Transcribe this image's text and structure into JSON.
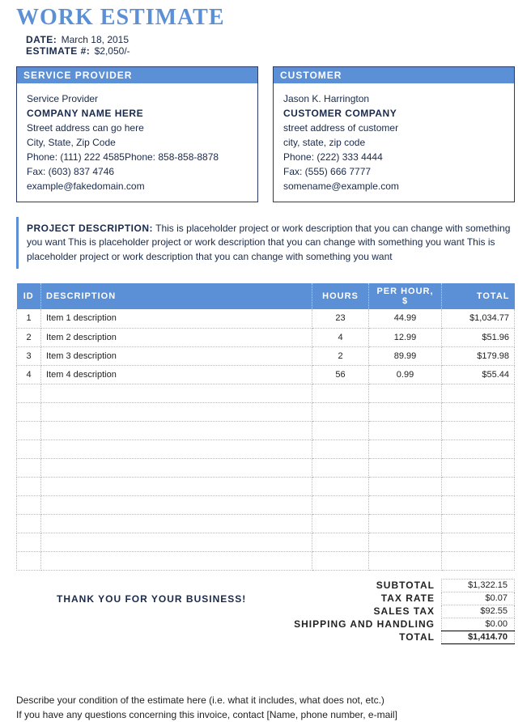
{
  "title": "WORK ESTIMATE",
  "meta": {
    "date_label": "DATE:",
    "date_value": "March 18, 2015",
    "est_label": "ESTIMATE #:",
    "est_value": "$2,050/-"
  },
  "provider": {
    "header": "SERVICE PROVIDER",
    "role": "Service Provider",
    "company": "COMPANY NAME HERE",
    "street": "Street address can go here",
    "citystate": "City, State, Zip Code",
    "phone": "Phone:  (111) 222 4585Phone: 858-858-8878",
    "fax": "Fax: (603) 837 4746",
    "email": "example@fakedomain.com"
  },
  "customer": {
    "header": "CUSTOMER",
    "name": "Jason K. Harrington",
    "company": "CUSTOMER COMPANY",
    "street": "street address of customer",
    "citystate": "city, state, zip code",
    "phone": "Phone: (222) 333 4444",
    "fax": "Fax: (555) 666 7777",
    "email": "somename@example.com"
  },
  "project": {
    "label": "PROJECT DESCRIPTION:",
    "text": "This is placeholder project or work description that you can change with something you want This is placeholder project or work description that you can change with something you want This is placeholder project or work description that you can change with something you want"
  },
  "table": {
    "headers": {
      "id": "ID",
      "desc": "DESCRIPTION",
      "hours": "HOURS",
      "rate": "PER HOUR, $",
      "total": "TOTAL"
    },
    "rows": [
      {
        "id": "1",
        "desc": "Item 1 description",
        "hours": "23",
        "rate": "44.99",
        "total": "$1,034.77"
      },
      {
        "id": "2",
        "desc": "Item 2 description",
        "hours": "4",
        "rate": "12.99",
        "total": "$51.96"
      },
      {
        "id": "3",
        "desc": "Item 3 description",
        "hours": "2",
        "rate": "89.99",
        "total": "$179.98"
      },
      {
        "id": "4",
        "desc": "Item 4 description",
        "hours": "56",
        "rate": "0.99",
        "total": "$55.44"
      }
    ],
    "blank_rows": 10
  },
  "thank_you": "THANK YOU FOR YOUR BUSINESS!",
  "totals": {
    "subtotal_label": "SUBTOTAL",
    "subtotal_value": "$1,322.15",
    "taxrate_label": "TAX RATE",
    "taxrate_value": "$0.07",
    "salestax_label": "SALES TAX",
    "salestax_value": "$92.55",
    "ship_label": "SHIPPING AND HANDLING",
    "ship_value": "$0.00",
    "total_label": "TOTAL",
    "total_value": "$1,414.70"
  },
  "footer": {
    "line1": "Describe your condition of the estimate here (i.e. what it includes, what does not, etc.)",
    "line2": "If you have any questions concerning this invoice, contact [Name, phone number, e-mail]"
  }
}
